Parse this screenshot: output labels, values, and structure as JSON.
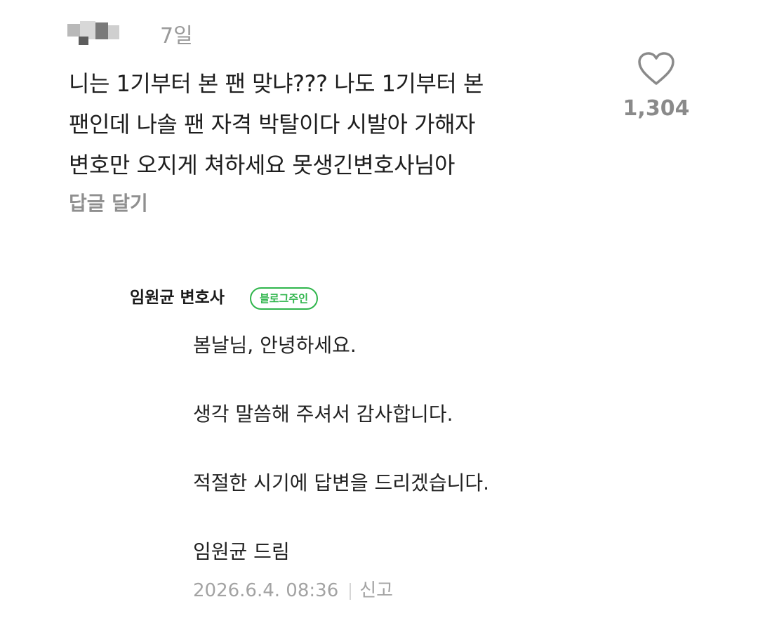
{
  "comment": {
    "age": "7일",
    "lines": [
      "니는 1기부터 본 팬 맞냐??? 나도 1기부터 본",
      "팬인데 나솔 팬 자격 박탈이다 시발아 가해자",
      "변호만 오지게 쳐하세요 못생긴변호사님아"
    ],
    "like_count": "1,304",
    "reply_label": "답글 달기",
    "like_icon": "heart-icon"
  },
  "reply": {
    "author": "임원균 변호사",
    "badge": "블로그주인",
    "lines": [
      "봄날님, 안녕하세요.",
      "생각 말씀해 주셔서 감사합니다.",
      "적절한 시기에 답변을 드리겠습니다.",
      "임원균 드림"
    ],
    "timestamp": "2026.6.4. 08:36",
    "report_label": "신고"
  },
  "colors": {
    "badge_green": "#2fb54b",
    "muted_gray": "#9a9a9a"
  }
}
